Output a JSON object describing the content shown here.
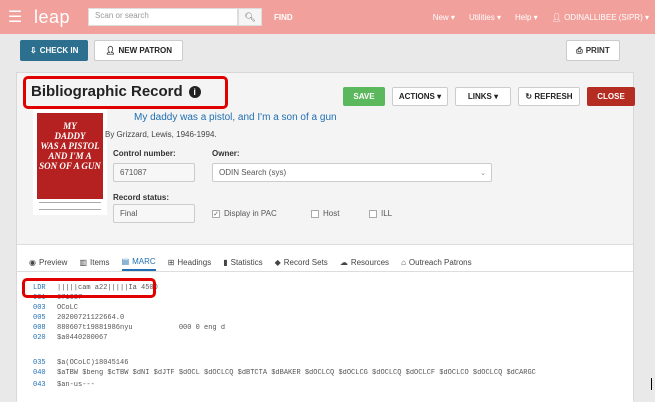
{
  "topbar": {
    "logo": "leap",
    "search_placeholder": "Scan or search",
    "find": "FIND",
    "nav": [
      "New ▾",
      "Utilities ▾",
      "Help ▾"
    ],
    "user": "ODINALLIBEE (SIPR) ▾"
  },
  "toolbar": {
    "checkin": "CHECK IN",
    "new_patron": "NEW PATRON",
    "print": "PRINT"
  },
  "record": {
    "heading": "Bibliographic Record",
    "save": "SAVE",
    "actions": "ACTIONS ▾",
    "links": "LINKS ▾",
    "refresh": "REFRESH",
    "close": "CLOSE",
    "book_title": "My daddy was a pistol, and I'm a son of a gun",
    "author": "By Grizzard, Lewis, 1946-1994.",
    "control_number_label": "Control number:",
    "control_number": "671087",
    "owner_label": "Owner:",
    "owner": "ODIN Search (sys)",
    "status_label": "Record status:",
    "status": "Final",
    "display_pac": "Display in PAC",
    "host": "Host",
    "ill": "ILL"
  },
  "tabs": [
    "Preview",
    "Items",
    "MARC",
    "Headings",
    "Statistics",
    "Record Sets",
    "Resources",
    "Outreach Patrons"
  ],
  "marc": [
    {
      "tag": "LDR",
      "value": "|||||cam a22|||||Ia 4500"
    },
    {
      "tag": "001",
      "value": "671087"
    },
    {
      "tag": "003",
      "value": "OCoLC"
    },
    {
      "tag": "005",
      "value": "20200721122664.0"
    },
    {
      "tag": "008",
      "value": "880607t19881986nyu           000 0 eng d"
    },
    {
      "tag": "020",
      "value": "$a0440200067"
    },
    {
      "tag": "035",
      "value": "$a(OCoLC)18045146"
    },
    {
      "tag": "040",
      "value": "$aTBW $beng $cTBW $dNI $dJTF $dOCL $dOCLCQ $dBTCTA $dBAKER $dOCLCQ $dOCLCG $dOCLCQ $dOCLCF $dOCLCO $dOCLCQ $dCARGC"
    },
    {
      "tag": "043",
      "value": "$an-us---"
    }
  ],
  "colors": {
    "topbar": "#f2a09c",
    "primary": "#2d6f8e",
    "save": "#5cb85c",
    "close": "#b52d22",
    "link": "#1f6fb2",
    "highlight": "#e00000"
  }
}
